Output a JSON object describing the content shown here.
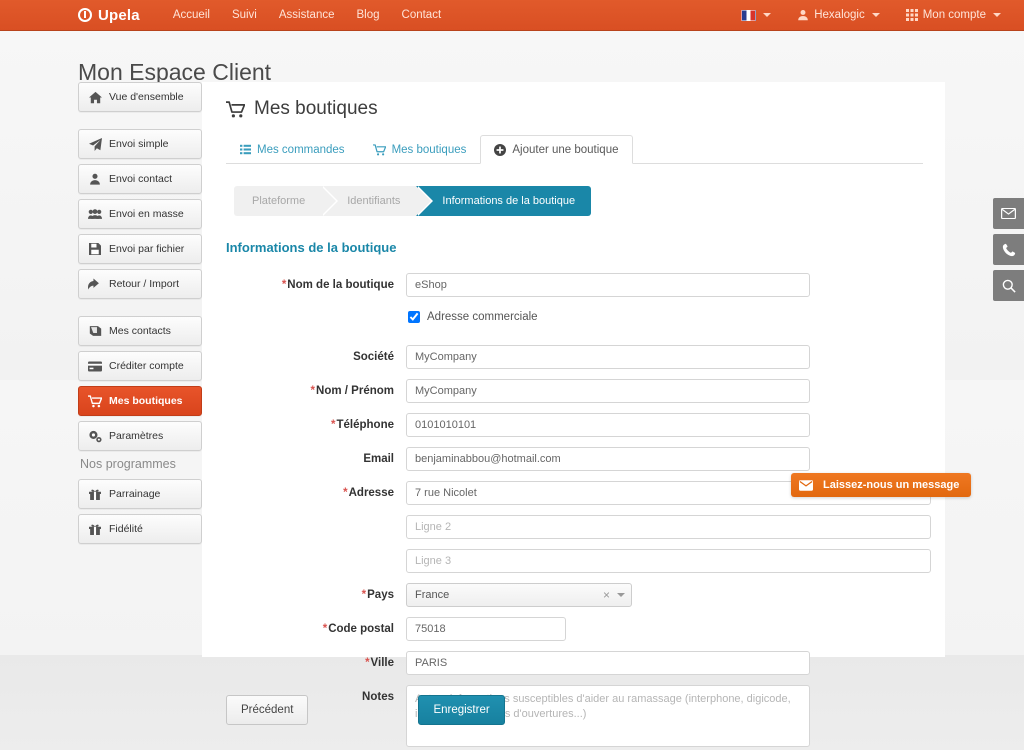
{
  "navbar": {
    "brand": "Upela",
    "links": [
      {
        "label": "Accueil"
      },
      {
        "label": "Suivi"
      },
      {
        "label": "Assistance"
      },
      {
        "label": "Blog"
      },
      {
        "label": "Contact"
      }
    ],
    "language": {
      "icon": "flag-icon",
      "label": ""
    },
    "user": {
      "icon": "user-icon",
      "label": "Hexalogic"
    },
    "account": {
      "icon": "grid-icon",
      "label": "Mon compte"
    },
    "accent_color": "#d94f23"
  },
  "page": {
    "title": "Mon Espace Client"
  },
  "sidebar": {
    "items": [
      {
        "label": "Vue d'ensemble",
        "icon": "home-icon",
        "active": false
      },
      {
        "label": "Envoi simple",
        "icon": "paper-plane-icon",
        "active": false
      },
      {
        "label": "Envoi contact",
        "icon": "user-icon",
        "active": false
      },
      {
        "label": "Envoi en masse",
        "icon": "users-icon",
        "active": false
      },
      {
        "label": "Envoi par fichier",
        "icon": "save-icon",
        "active": false
      },
      {
        "label": "Retour / Import",
        "icon": "arrow-back-icon",
        "active": false
      },
      {
        "label": "Mes contacts",
        "icon": "book-icon",
        "active": false
      },
      {
        "label": "Créditer compte",
        "icon": "credit-card-icon",
        "active": false
      },
      {
        "label": "Mes boutiques",
        "icon": "cart-icon",
        "active": true
      },
      {
        "label": "Paramètres",
        "icon": "gears-icon",
        "active": false
      }
    ],
    "programs_label": "Nos programmes",
    "programs": [
      {
        "label": "Parrainage",
        "icon": "gift-icon"
      },
      {
        "label": "Fidélité",
        "icon": "gift-icon"
      }
    ],
    "active_color": "#d9441c"
  },
  "main": {
    "panel_title": "Mes boutiques",
    "panel_title_icon": "cart-icon",
    "tabs": [
      {
        "label": "Mes commandes",
        "icon": "list-icon",
        "active": false
      },
      {
        "label": "Mes boutiques",
        "icon": "cart-icon",
        "active": false
      },
      {
        "label": "Ajouter une boutique",
        "icon": "plus-circle-icon",
        "active": true
      }
    ],
    "steps": [
      {
        "label": "Plateforme",
        "current": false
      },
      {
        "label": "Identifiants",
        "current": false
      },
      {
        "label": "Informations de la boutique",
        "current": true
      }
    ],
    "step_active_color": "#1a87a8",
    "section_title": "Informations de la boutique",
    "form": {
      "shop_name": {
        "label": "Nom de la boutique",
        "required": true,
        "value": "eShop",
        "placeholder": ""
      },
      "commercial_address": {
        "label": "Adresse commerciale",
        "checked": true
      },
      "company": {
        "label": "Société",
        "required": false,
        "value": "MyCompany",
        "placeholder": ""
      },
      "name": {
        "label": "Nom / Prénom",
        "required": true,
        "value": "MyCompany",
        "placeholder": ""
      },
      "phone": {
        "label": "Téléphone",
        "required": true,
        "value": "0101010101",
        "placeholder": ""
      },
      "email": {
        "label": "Email",
        "required": false,
        "value": "benjaminabbou@hotmail.com",
        "placeholder": ""
      },
      "address1": {
        "label": "Adresse",
        "required": true,
        "value": "7 rue Nicolet",
        "placeholder": ""
      },
      "address2": {
        "label": "",
        "required": false,
        "value": "",
        "placeholder": "Ligne 2"
      },
      "address3": {
        "label": "",
        "required": false,
        "value": "",
        "placeholder": "Ligne 3"
      },
      "country": {
        "label": "Pays",
        "required": true,
        "value": "France",
        "clear": "×"
      },
      "postal_code": {
        "label": "Code postal",
        "required": true,
        "value": "75018",
        "placeholder": ""
      },
      "city": {
        "label": "Ville",
        "required": true,
        "value": "PARIS",
        "placeholder": ""
      },
      "notes": {
        "label": "Notes",
        "required": false,
        "value": "",
        "placeholder": "Autres informations susceptibles d'aider au ramassage (interphone, digicode, instructions, heures d'ouvertures...)"
      }
    },
    "buttons": {
      "previous": "Précédent",
      "save": "Enregistrer",
      "save_color": "#17819f"
    }
  },
  "chat": {
    "label": "Laissez-nous un message",
    "icon": "envelope-icon",
    "color": "#e2680f"
  },
  "rail": [
    {
      "icon": "envelope-icon",
      "name": "contact-email"
    },
    {
      "icon": "phone-icon",
      "name": "contact-phone"
    },
    {
      "icon": "search-icon",
      "name": "search"
    }
  ]
}
